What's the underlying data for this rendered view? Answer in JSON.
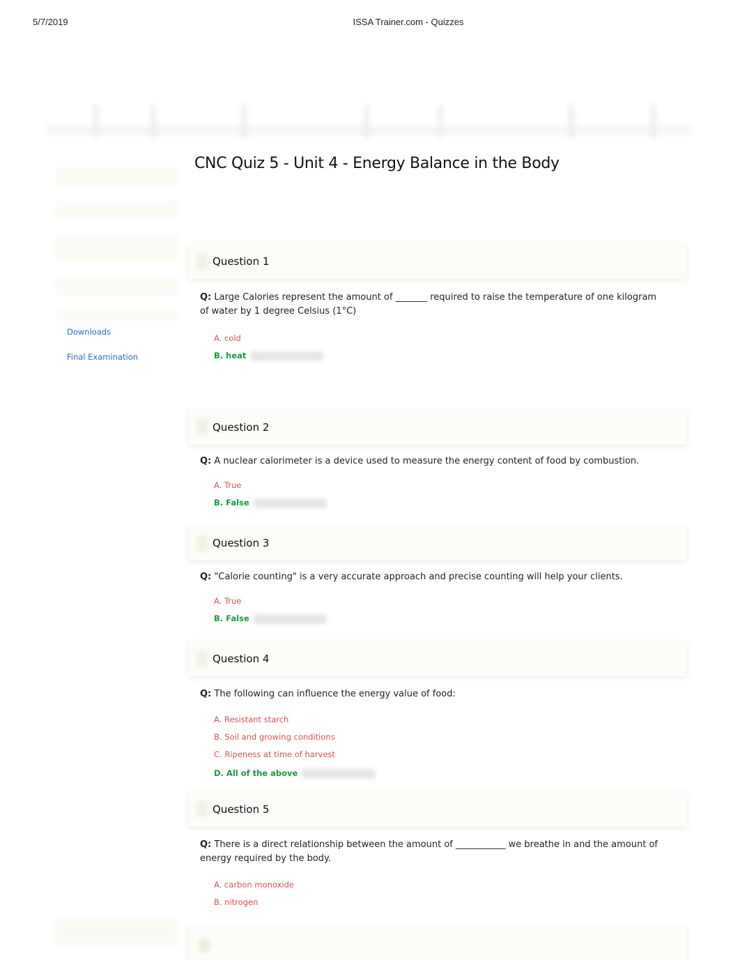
{
  "print_header": {
    "date": "5/7/2019",
    "title": "ISSA Trainer.com - Quizzes"
  },
  "page": {
    "title": "CNC Quiz 5 - Unit 4 - Energy Balance in the Body"
  },
  "sidebar": {
    "links": [
      {
        "label": "Downloads"
      },
      {
        "label": "Final Examination"
      }
    ]
  },
  "colors": {
    "wrong_answer": "#d9534f",
    "correct_answer": "#179a3f",
    "link": "#2a6fb8"
  },
  "questions": [
    {
      "header": "Question 1",
      "q_prefix": "Q:",
      "text": "Large Calories represent the amount of _______ required to raise the temperature of one kilogram of water by 1 degree Celsius (1°C)",
      "answers": [
        {
          "label": "A. cold",
          "correct": false
        },
        {
          "label": "B. heat",
          "correct": true
        }
      ]
    },
    {
      "header": "Question 2",
      "q_prefix": "Q:",
      "text": "A nuclear calorimeter is a device used to measure the energy content of food by combustion.",
      "answers": [
        {
          "label": "A. True",
          "correct": false
        },
        {
          "label": "B. False",
          "correct": true
        }
      ]
    },
    {
      "header": "Question 3",
      "q_prefix": "Q:",
      "text": "\"Calorie counting\" is a very accurate approach and precise counting will help your clients.",
      "answers": [
        {
          "label": "A. True",
          "correct": false
        },
        {
          "label": "B. False",
          "correct": true
        }
      ]
    },
    {
      "header": "Question 4",
      "q_prefix": "Q:",
      "text": "The following can influence the energy value of food:",
      "answers": [
        {
          "label": "A. Resistant starch",
          "correct": false
        },
        {
          "label": "B. Soil and growing conditions",
          "correct": false
        },
        {
          "label": "C. Ripeness at time of harvest",
          "correct": false
        },
        {
          "label": "D. All of the above",
          "correct": true
        }
      ]
    },
    {
      "header": "Question 5",
      "q_prefix": "Q:",
      "text": "There is a direct relationship between the amount of ___________ we breathe in and the amount of energy required by the body.",
      "answers": [
        {
          "label": "A. carbon monoxide",
          "correct": false
        },
        {
          "label": "B. nitrogen",
          "correct": false
        }
      ]
    }
  ]
}
